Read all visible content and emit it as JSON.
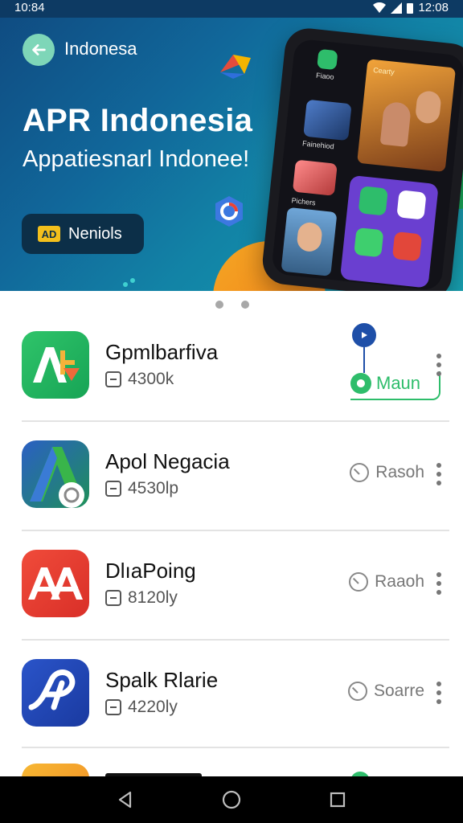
{
  "status_bar": {
    "time": "10:84",
    "clock": "12:08"
  },
  "hero": {
    "top_label": "Indonesa",
    "title": "APR Indonesia",
    "subtitle": "Appatiesnarl Indonee!",
    "cta_icon_text": "AD",
    "cta_label": "Neniols",
    "phone": {
      "tile1_label": "Fiaoo",
      "tile2_label": "Cearty",
      "tile3_label": "Fainehiod",
      "tile4_label": "Pichers"
    }
  },
  "pager": {
    "pages": 2
  },
  "apps": [
    {
      "name": "Gpmlbarfiva",
      "size": "4300k",
      "action": "Maun",
      "icon_text": "A"
    },
    {
      "name": "Apol Negacia",
      "size": "4530lp",
      "action": "Rasoh",
      "icon_text": "A"
    },
    {
      "name": "DlıaPoing",
      "size": "8120ly",
      "action": "Raaoh",
      "icon_text": "AA"
    },
    {
      "name": "Spalk Rlarie",
      "size": "4220ly",
      "action": "Soarre",
      "icon_text": "A"
    }
  ],
  "colors": {
    "hero_start": "#0f4a80",
    "hero_end": "#17a0b0",
    "accent_green": "#2ebd6b",
    "accent_blue": "#1e4fa8"
  },
  "icons": {
    "back": "arrow-left-icon",
    "more": "more-vertical-icon",
    "clock": "clock-icon",
    "size": "storage-icon",
    "nav_back": "triangle-back-icon",
    "nav_home": "circle-home-icon",
    "nav_recents": "square-recents-icon"
  }
}
